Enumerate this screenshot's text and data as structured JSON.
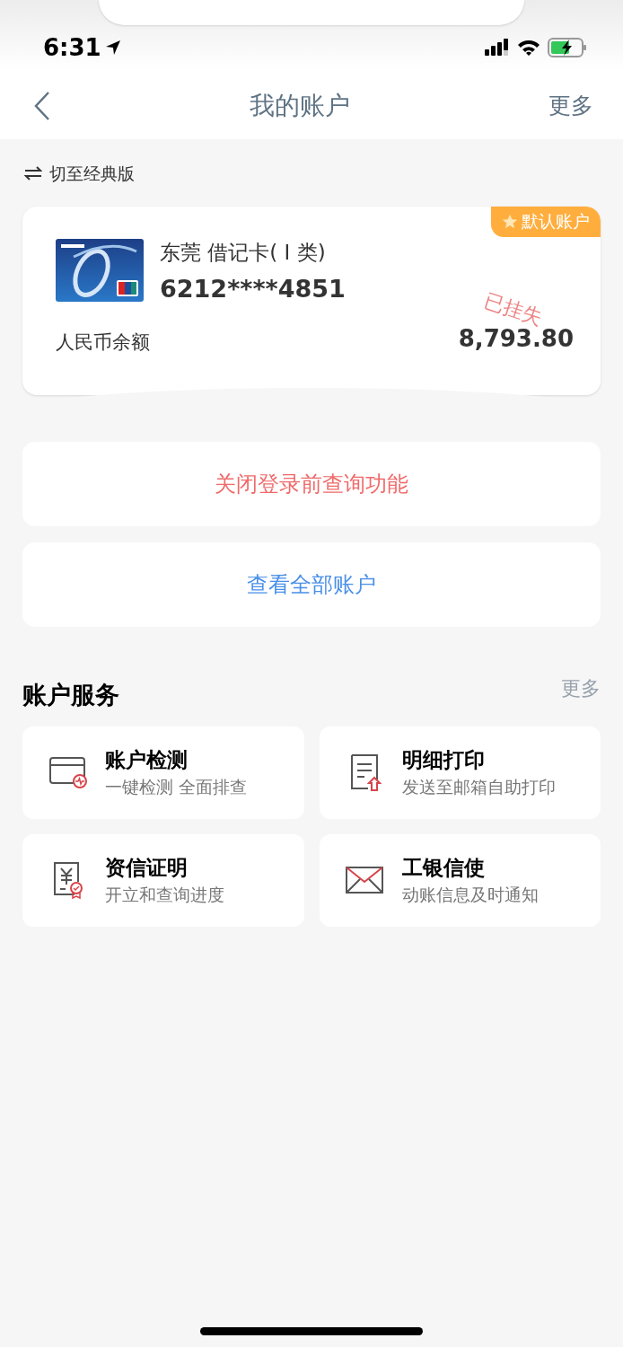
{
  "status_bar": {
    "time": "6:31"
  },
  "nav": {
    "title": "我的账户",
    "action": "更多"
  },
  "switch_link": {
    "label": "切至经典版"
  },
  "account_card": {
    "badge": "默认账户",
    "name": "东莞 借记卡( Ⅰ 类)",
    "number": "6212****4851",
    "balance_label": "人民币余额",
    "balance": "8,793.80",
    "stamp": "已挂失"
  },
  "buttons": [
    {
      "label": "关闭登录前查询功能",
      "kind": "danger"
    },
    {
      "label": "查看全部账户",
      "kind": "link"
    }
  ],
  "services": {
    "title": "账户服务",
    "more": "更多",
    "items": [
      {
        "kind": "check",
        "title": "账户检测",
        "subtitle": "一键检测 全面排查"
      },
      {
        "kind": "print",
        "title": "明细打印",
        "subtitle": "发送至邮箱自助打印"
      },
      {
        "kind": "credit",
        "title": "资信证明",
        "subtitle": "开立和查询进度"
      },
      {
        "kind": "mail",
        "title": "工银信使",
        "subtitle": "动账信息及时通知"
      }
    ]
  }
}
